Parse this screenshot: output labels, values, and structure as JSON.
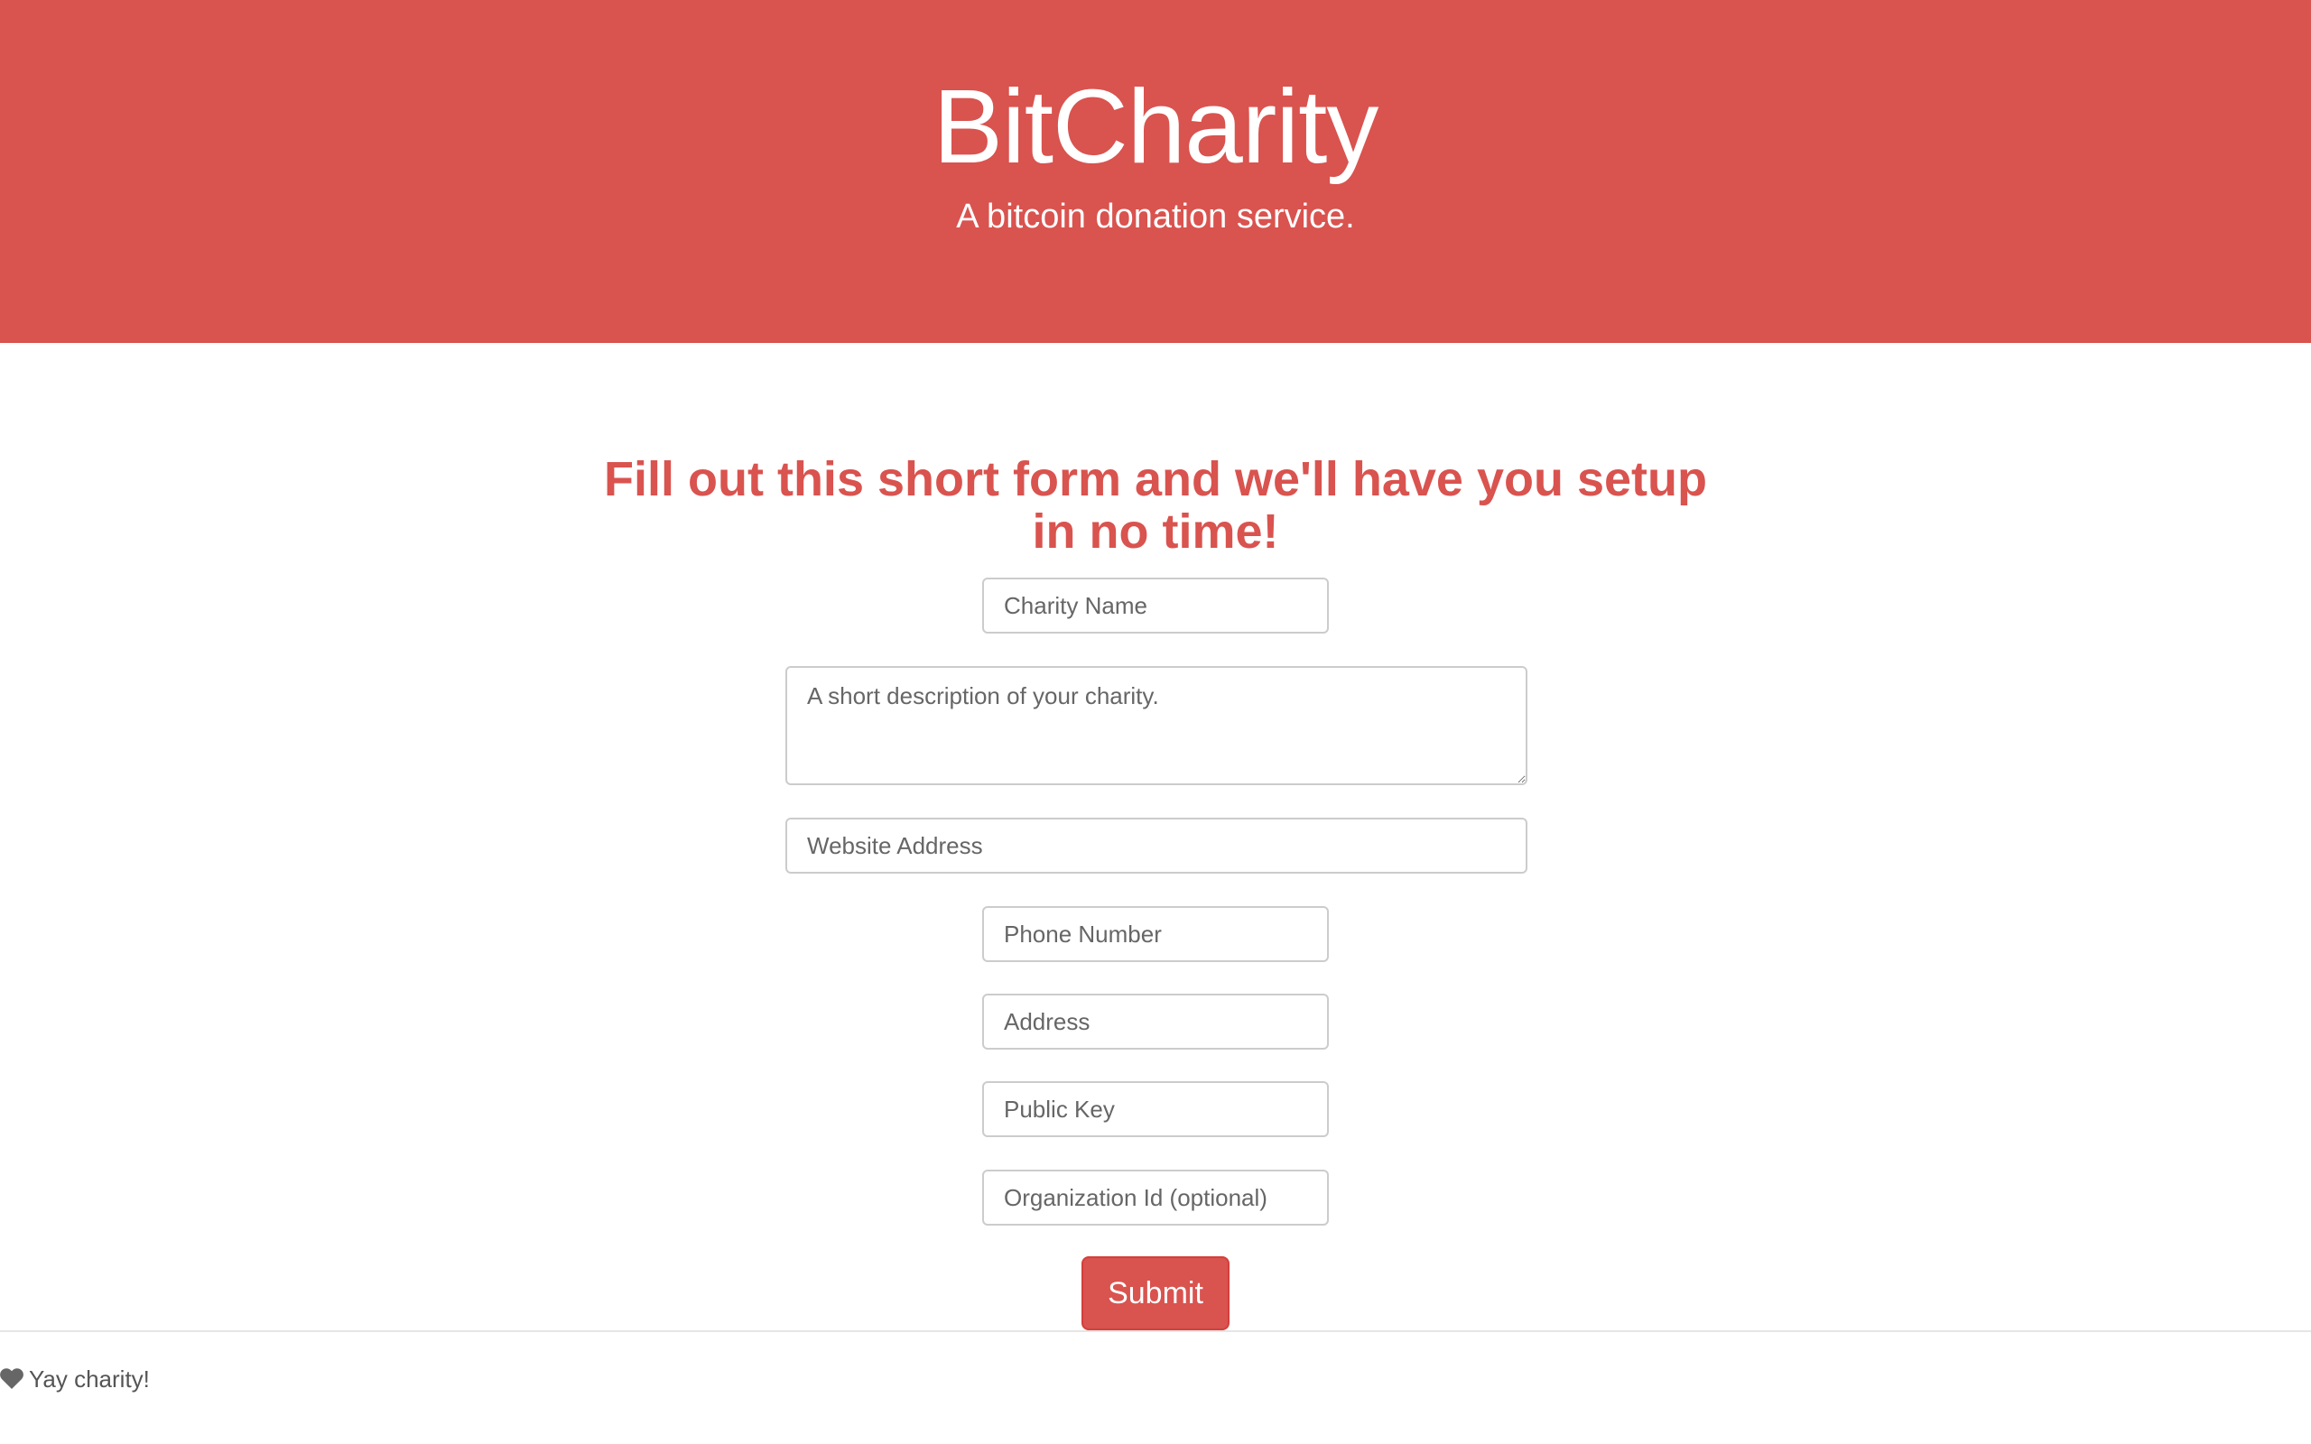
{
  "hero": {
    "title": "BitCharity",
    "subtitle": "A bitcoin donation service."
  },
  "form": {
    "heading": "Fill out this short form and we'll have you setup in no time!",
    "fields": {
      "charity_name": "Charity Name",
      "description": "A short description of your charity.",
      "website": "Website Address",
      "phone": "Phone Number",
      "address": "Address",
      "public_key": "Public Key",
      "organization_id": "Organization Id (optional)"
    },
    "submit_label": "Submit"
  },
  "footer": {
    "icon": "heart-icon",
    "text": "Yay charity!"
  },
  "colors": {
    "brand": "#d9534f",
    "text": "#555555"
  }
}
